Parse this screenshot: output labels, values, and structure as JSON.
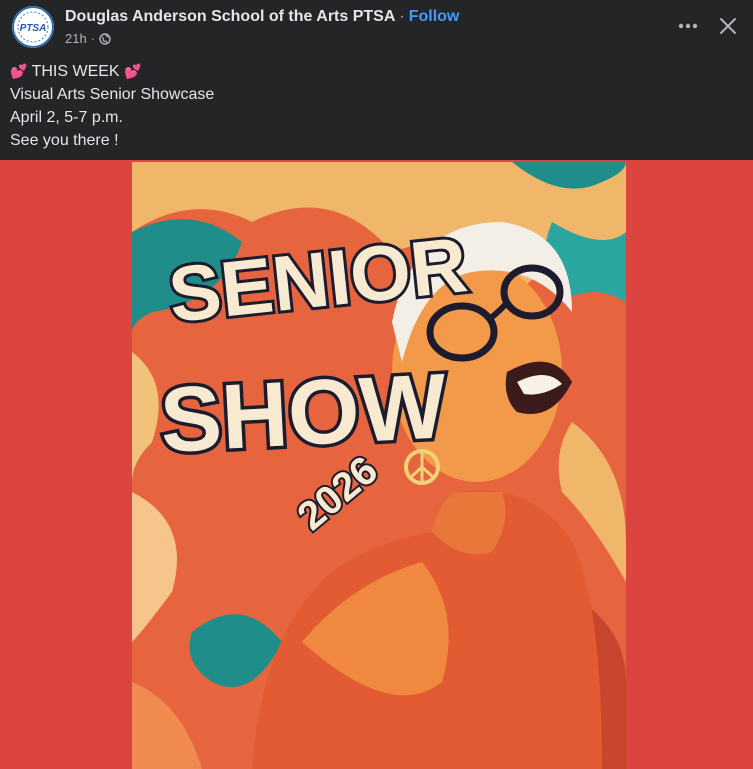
{
  "post": {
    "page_name": "Douglas Anderson School of the Arts PTSA",
    "separator": "·",
    "follow_label": "Follow",
    "time": "21h",
    "meta_separator": "·",
    "avatar_text": "PTSA",
    "privacy_icon": "globe-icon",
    "more_icon": "more-options-icon",
    "close_icon": "close-icon",
    "text_lines": {
      "line1": "THIS WEEK",
      "line1_emoji": "💕",
      "line2": "Visual Arts Senior Showcase",
      "line3": "April 2, 5-7 p.m.",
      "line4": "See you there !"
    }
  },
  "poster": {
    "title_word1": "SENIOR",
    "title_word2": "SHOW",
    "year": "2026"
  },
  "colors": {
    "background": "#242526",
    "media_background": "#dc4440",
    "follow": "#4599ff",
    "text": "#e4e6eb",
    "muted": "#b0b3b8"
  }
}
